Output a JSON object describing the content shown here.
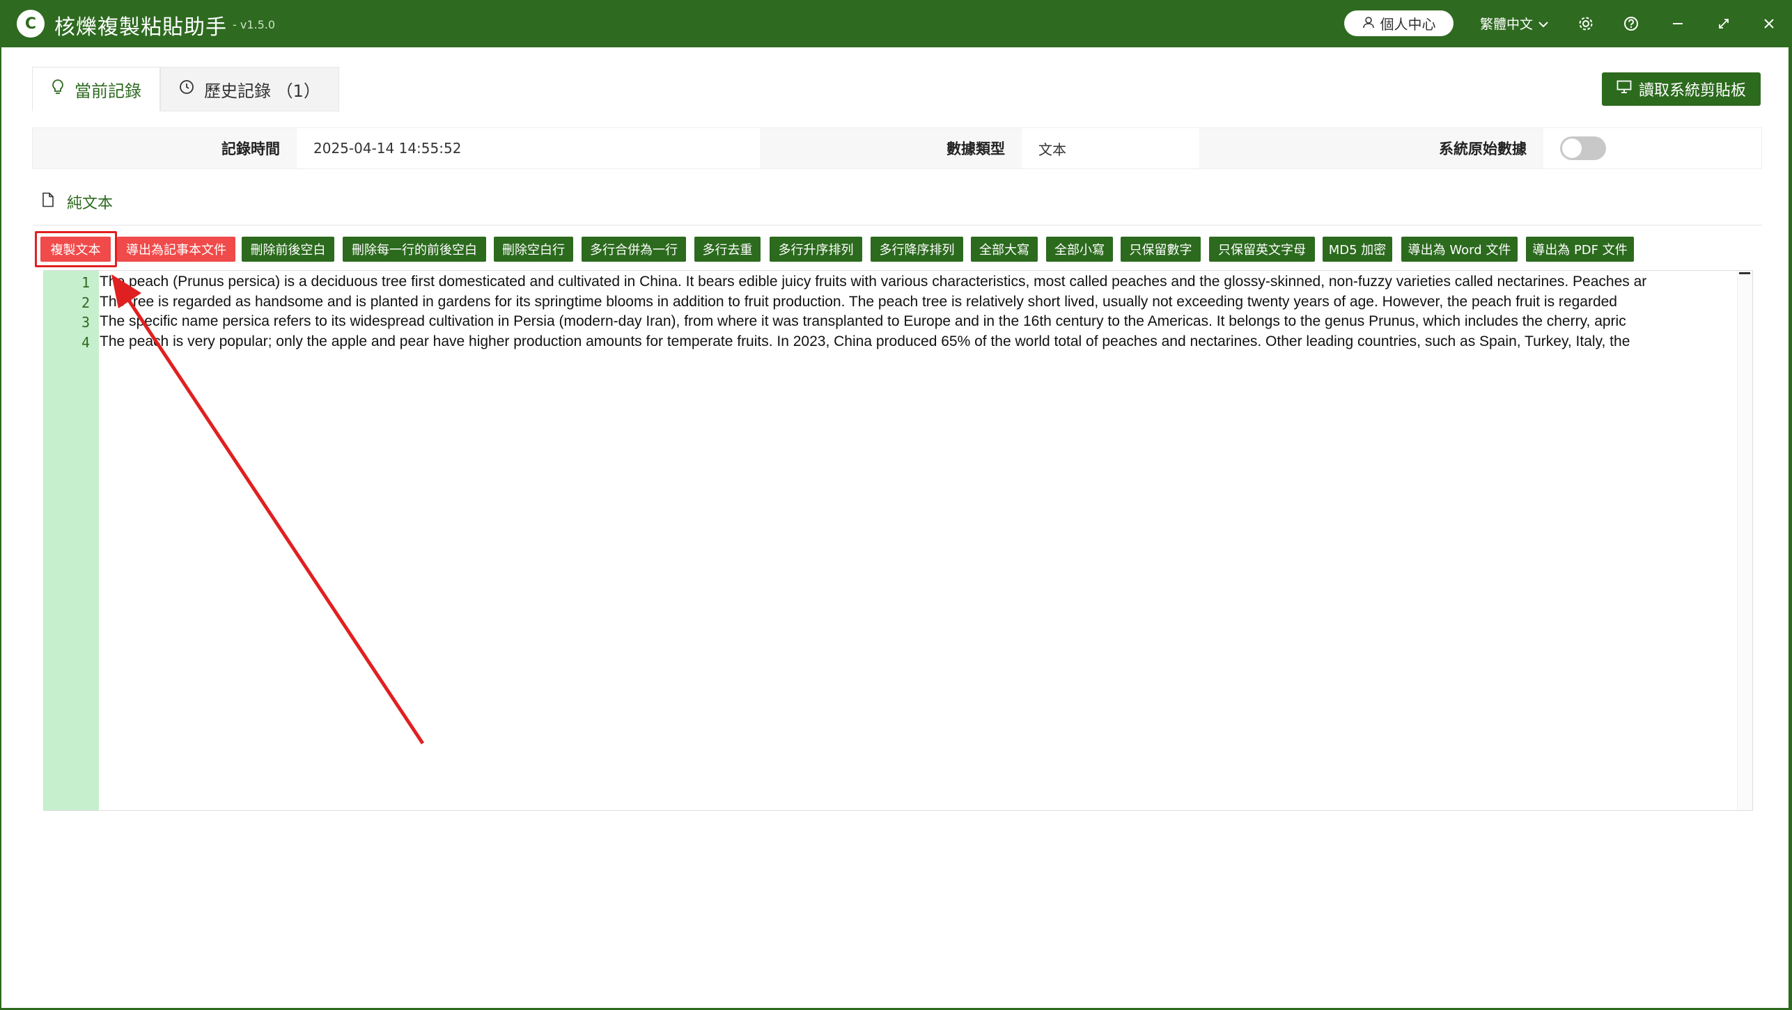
{
  "app": {
    "title": "核爍複製粘貼助手",
    "version": "- v1.5.0",
    "logo_text": "C"
  },
  "titlebar": {
    "user_center": "個人中心",
    "language": "繁體中文",
    "icons": [
      "user-icon",
      "chevron-down-icon",
      "gear-icon",
      "help-icon",
      "minimize-icon",
      "maximize-icon",
      "close-icon"
    ]
  },
  "tabs": [
    {
      "label": "當前記錄",
      "icon": "bulb-icon",
      "active": true
    },
    {
      "label": "歷史記錄 （1）",
      "icon": "clock-icon",
      "active": false
    }
  ],
  "read_clipboard_button": "讀取系統剪貼板",
  "info": {
    "time_label": "記錄時間",
    "time_value": "2025-04-14 14:55:52",
    "type_label": "數據類型",
    "type_value": "文本",
    "raw_label": "系統原始數據",
    "raw_enabled": false
  },
  "subtab": {
    "label": "純文本",
    "icon": "document-icon"
  },
  "toolbar": [
    {
      "label": "複製文本",
      "color": "red"
    },
    {
      "label": "導出為記事本文件",
      "color": "red"
    },
    {
      "label": "刪除前後空白",
      "color": "green"
    },
    {
      "label": "刪除每一行的前後空白",
      "color": "green"
    },
    {
      "label": "刪除空白行",
      "color": "green"
    },
    {
      "label": "多行合併為一行",
      "color": "green"
    },
    {
      "label": "多行去重",
      "color": "green"
    },
    {
      "label": "多行升序排列",
      "color": "green"
    },
    {
      "label": "多行降序排列",
      "color": "green"
    },
    {
      "label": "全部大寫",
      "color": "green"
    },
    {
      "label": "全部小寫",
      "color": "green"
    },
    {
      "label": "只保留數字",
      "color": "green"
    },
    {
      "label": "只保留英文字母",
      "color": "green"
    },
    {
      "label": "MD5 加密",
      "color": "green"
    },
    {
      "label": "導出為 Word 文件",
      "color": "green"
    },
    {
      "label": "導出為 PDF 文件",
      "color": "green"
    }
  ],
  "editor": {
    "lines": [
      {
        "num": "1",
        "text": "The peach (Prunus persica) is a deciduous tree first domesticated and cultivated in China. It bears edible juicy fruits with various characteristics, most called peaches and the glossy-skinned, non-fuzzy varieties called nectarines. Peaches ar"
      },
      {
        "num": "2",
        "text": "The tree is regarded as handsome and is planted in gardens for its springtime blooms in addition to fruit production. The peach tree is relatively short lived, usually not exceeding twenty years of age. However, the peach fruit is regarded"
      },
      {
        "num": "3",
        "text": "The specific name persica refers to its widespread cultivation in Persia (modern-day Iran), from where it was transplanted to Europe and in the 16th century to the Americas. It belongs to the genus Prunus, which includes the cherry, apric"
      },
      {
        "num": "4",
        "text": "The peach is very popular; only the apple and pear have higher production amounts for temperate fruits. In 2023, China produced 65% of the world total of peaches and nectarines. Other leading countries, such as Spain, Turkey, Italy, the"
      }
    ]
  },
  "colors": {
    "brand_green": "#2c6a1e",
    "danger_red": "#f04a4a",
    "gutter_green": "#c6efce",
    "annotation_red": "#e02020"
  }
}
